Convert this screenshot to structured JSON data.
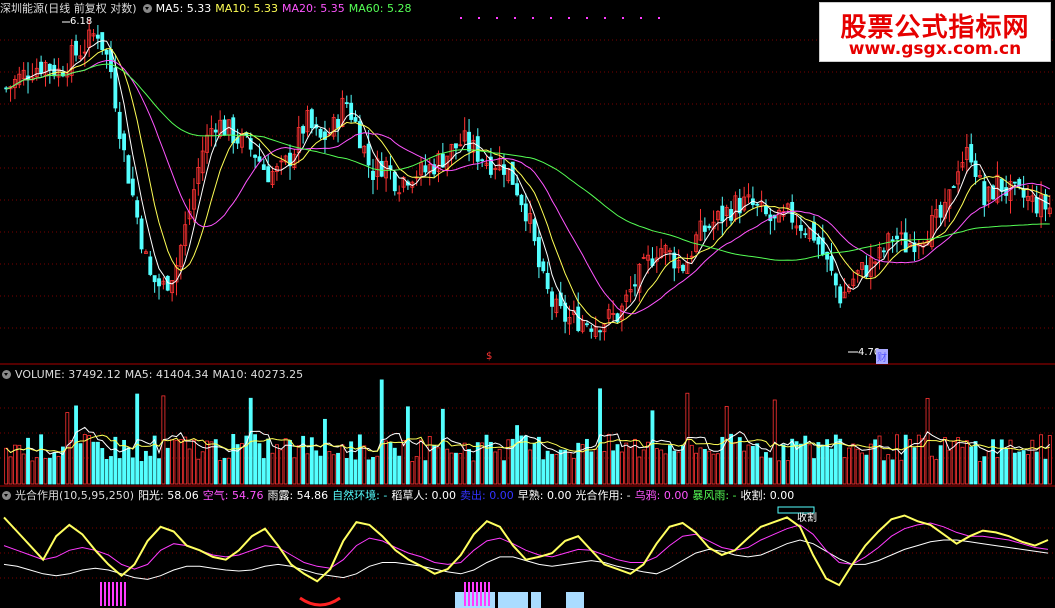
{
  "colors": {
    "bg": "#000000",
    "up": "#ff3333",
    "down": "#54ffff",
    "ma5": "#ffffff",
    "ma10": "#ffff55",
    "ma20": "#ff55ff",
    "ma60": "#55ff55",
    "grid": "#7a0000",
    "divider": "#aa0000",
    "yellow": "#ffff60",
    "magenta": "#ff3bff",
    "white": "#ffffff"
  },
  "header_price": {
    "title": "深圳能源(日线 前复权 对数)",
    "ma5": "MA5: 5.33",
    "ma10": "MA10: 5.33",
    "ma20": "MA20: 5.35",
    "ma60": "MA60: 5.28"
  },
  "header_volume": {
    "title": "VOLUME: 37492.12",
    "ma5": "MA5: 41404.34",
    "ma10": "MA10: 40273.25"
  },
  "header_indicator": {
    "title": "光合作用(10,5,95,250)",
    "items": [
      {
        "label": "阳光: 58.06",
        "color": "#ffffff"
      },
      {
        "label": "空气: 54.76",
        "color": "#ff55ff"
      },
      {
        "label": "雨露: 54.86",
        "color": "#ffffff"
      },
      {
        "label": "自然环境: -",
        "color": "#55ffff"
      },
      {
        "label": "稻草人: 0.00",
        "color": "#ffffff"
      },
      {
        "label": "卖出: 0.00",
        "color": "#3333ff"
      },
      {
        "label": "早熟: 0.00",
        "color": "#ffffff"
      },
      {
        "label": "光合作用: -",
        "color": "#ffffff"
      },
      {
        "label": "乌鸦: 0.00",
        "color": "#ff55ff"
      },
      {
        "label": "暴风雨: -",
        "color": "#55ff55"
      },
      {
        "label": "收割: 0.00",
        "color": "#ffffff"
      }
    ]
  },
  "annotations": {
    "high_label": "6.18",
    "low_label": "4.70",
    "low_marker": "财",
    "bottom_marker": "$",
    "harvest": "收割"
  },
  "watermark": {
    "title": "股票公式指标网",
    "url": "www.gsgx.com.cn"
  },
  "chart_data": {
    "type": "candlestick",
    "price_range": [
      4.7,
      6.18
    ],
    "price_points": [
      5.9,
      5.95,
      6.0,
      6.02,
      5.98,
      6.05,
      6.1,
      6.18,
      6.0,
      5.6,
      5.3,
      5.0,
      4.95,
      5.05,
      5.3,
      5.6,
      5.75,
      5.7,
      5.65,
      5.6,
      5.5,
      5.5,
      5.6,
      5.75,
      5.65,
      5.7,
      5.85,
      5.7,
      5.5,
      5.55,
      5.45,
      5.5,
      5.5,
      5.55,
      5.6,
      5.65,
      5.6,
      5.55,
      5.55,
      5.45,
      5.3,
      5.0,
      4.85,
      4.8,
      4.8,
      4.78,
      4.8,
      4.82,
      4.95,
      5.05,
      5.15,
      5.1,
      5.05,
      5.2,
      5.25,
      5.3,
      5.35,
      5.35,
      5.3,
      5.25,
      5.3,
      5.25,
      5.2,
      5.05,
      4.9,
      5.0,
      5.05,
      5.1,
      5.2,
      5.15,
      5.2,
      5.25,
      5.3,
      5.55,
      5.6,
      5.35,
      5.45,
      5.4,
      5.38,
      5.35,
      5.33
    ],
    "volume_range": [
      0,
      80000
    ],
    "volume": {
      "last": 37492.12,
      "ma5": 41404.34,
      "ma10": 40273.25
    },
    "indicator": {
      "name": "光合作用(10,5,95,250)",
      "yellow": [
        90,
        75,
        60,
        45,
        70,
        82,
        72,
        55,
        40,
        28,
        40,
        65,
        80,
        75,
        60,
        55,
        48,
        45,
        55,
        70,
        78,
        60,
        40,
        30,
        22,
        35,
        65,
        85,
        82,
        70,
        55,
        45,
        38,
        30,
        35,
        50,
        72,
        86,
        80,
        60,
        45,
        48,
        52,
        65,
        70,
        55,
        40,
        35,
        30,
        40,
        62,
        80,
        84,
        74,
        58,
        50,
        55,
        68,
        80,
        85,
        90,
        80,
        50,
        25,
        18,
        40,
        60,
        75,
        88,
        92,
        86,
        82,
        72,
        62,
        70,
        76,
        74,
        70,
        64,
        60,
        66
      ],
      "magenta": [
        60,
        55,
        50,
        45,
        48,
        55,
        58,
        55,
        50,
        40,
        35,
        40,
        55,
        62,
        60,
        55,
        50,
        48,
        50,
        55,
        60,
        58,
        50,
        42,
        38,
        36,
        45,
        60,
        68,
        65,
        58,
        52,
        48,
        42,
        40,
        42,
        55,
        65,
        68,
        62,
        55,
        50,
        48,
        52,
        56,
        55,
        50,
        45,
        42,
        42,
        48,
        60,
        70,
        72,
        65,
        58,
        55,
        58,
        66,
        72,
        78,
        82,
        72,
        55,
        42,
        40,
        48,
        58,
        70,
        78,
        82,
        84,
        80,
        74,
        70,
        70,
        68,
        66,
        62,
        58,
        56
      ],
      "white": [
        40,
        38,
        34,
        30,
        28,
        30,
        34,
        36,
        34,
        30,
        26,
        24,
        28,
        34,
        38,
        38,
        36,
        34,
        33,
        34,
        38,
        40,
        38,
        34,
        30,
        28,
        26,
        30,
        38,
        42,
        42,
        40,
        38,
        35,
        32,
        30,
        34,
        42,
        48,
        48,
        44,
        40,
        38,
        40,
        42,
        44,
        42,
        38,
        35,
        32,
        30,
        36,
        44,
        52,
        56,
        54,
        50,
        48,
        50,
        56,
        62,
        66,
        62,
        54,
        46,
        40,
        40,
        44,
        50,
        56,
        60,
        64,
        66,
        66,
        64,
        62,
        60,
        58,
        56,
        54,
        52
      ]
    }
  }
}
